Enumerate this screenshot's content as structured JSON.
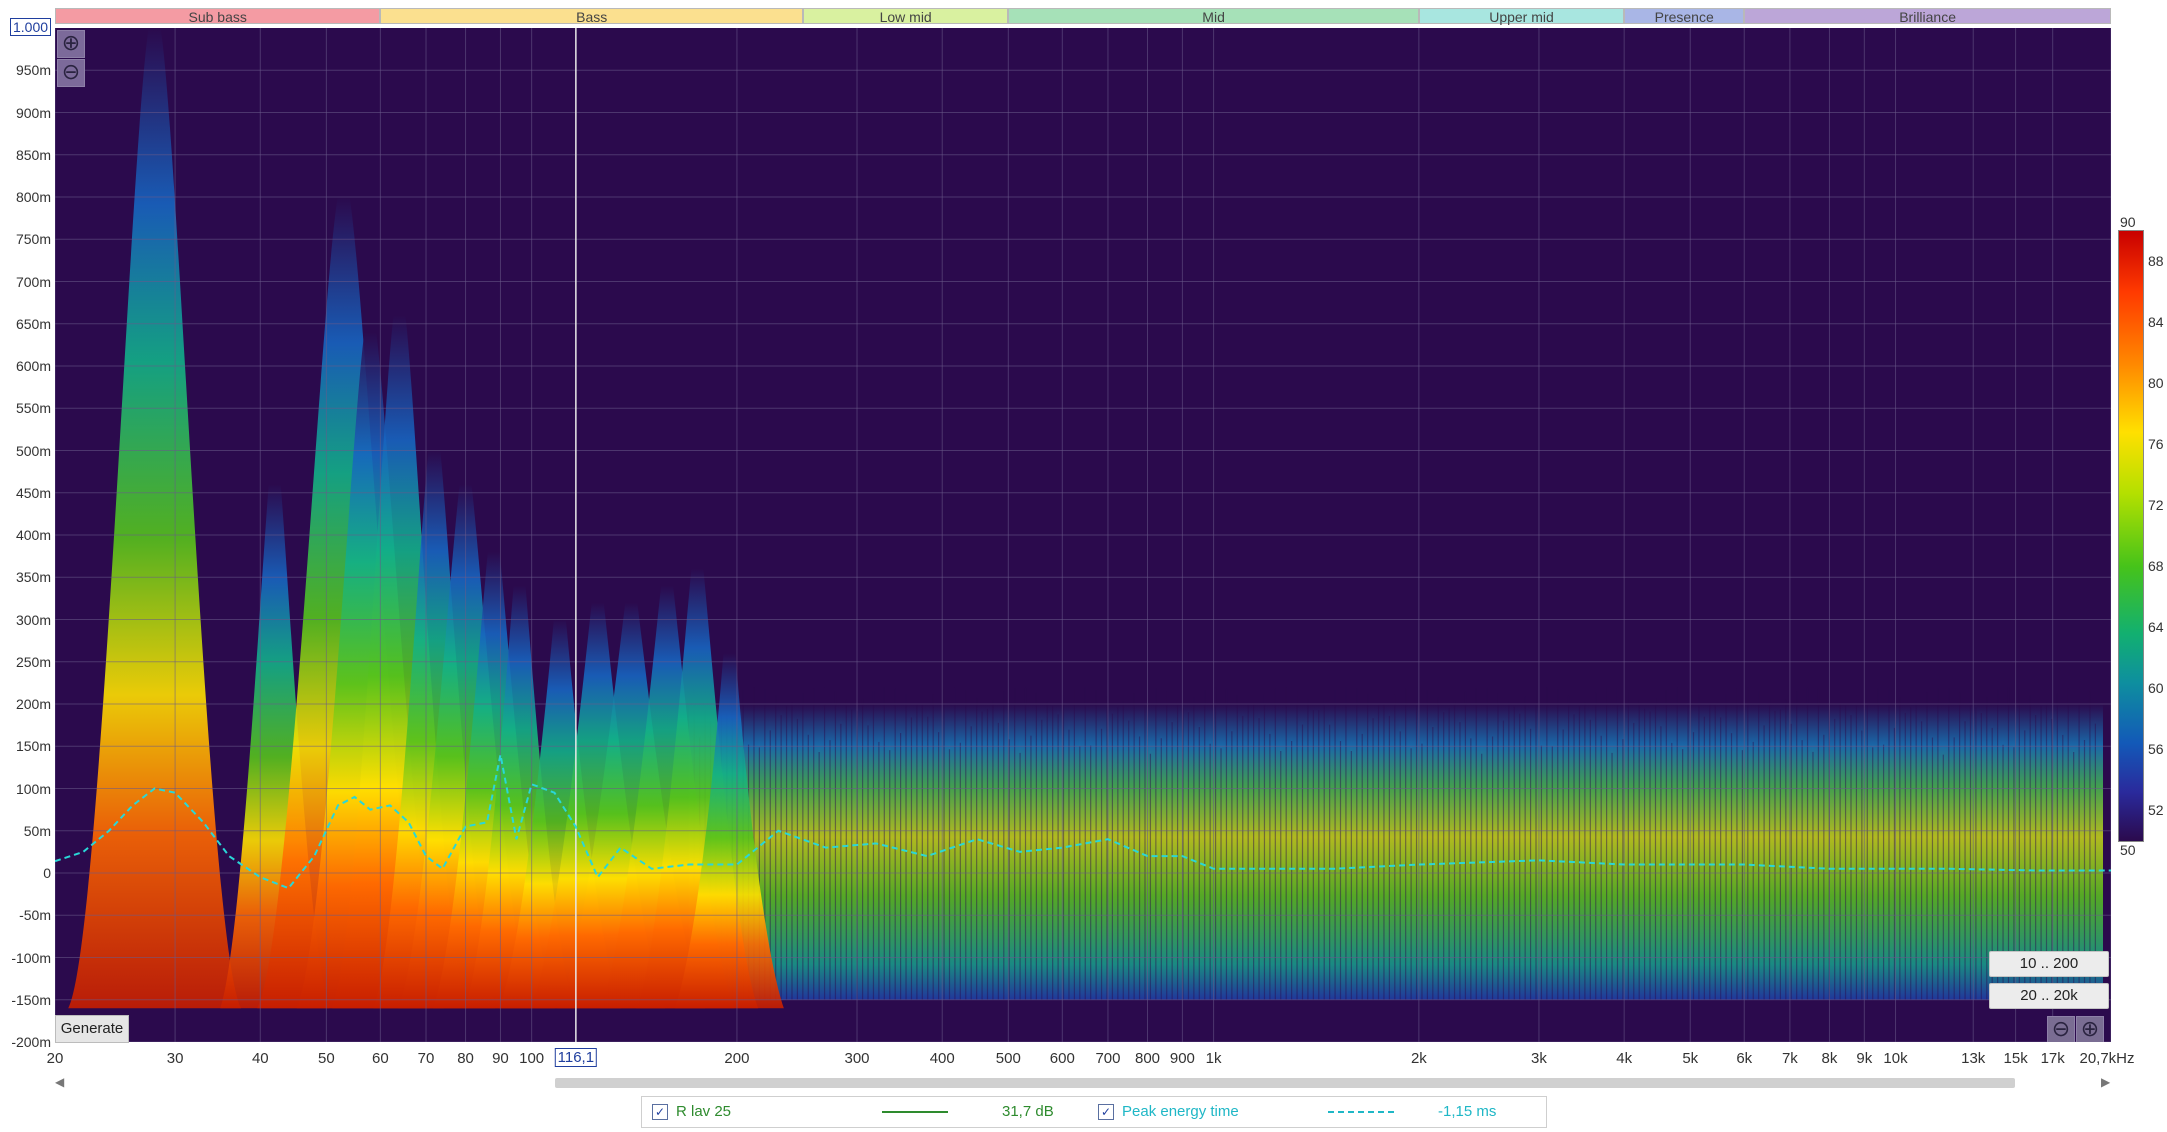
{
  "bands": [
    {
      "label": "Sub bass",
      "color": "#f49ba3",
      "from": 20,
      "to": 60
    },
    {
      "label": "Bass",
      "color": "#fbe08f",
      "from": 60,
      "to": 250
    },
    {
      "label": "Low mid",
      "color": "#d9f1a0",
      "from": 250,
      "to": 500
    },
    {
      "label": "Mid",
      "color": "#a6e1b8",
      "from": 500,
      "to": 2000
    },
    {
      "label": "Upper mid",
      "color": "#a8e6e0",
      "from": 2000,
      "to": 4000
    },
    {
      "label": "Presence",
      "color": "#a9b6e6",
      "from": 4000,
      "to": 6000
    },
    {
      "label": "Brilliance",
      "color": "#bca6d8",
      "from": 6000,
      "to": 20700
    }
  ],
  "top_value": "1.000",
  "cursor_label": "116,1",
  "generate_label": "Generate",
  "range_buttons": [
    "10 .. 200",
    "20 .. 20k"
  ],
  "zoom_in_symbol": "⊕",
  "zoom_out_symbol": "⊖",
  "scroll_left": "◀",
  "scroll_right": "▶",
  "legend": {
    "series1": {
      "checked": "✓",
      "name": "R lav 25",
      "value": "31,7 dB",
      "color": "#2e8b2e"
    },
    "series2": {
      "checked": "✓",
      "name": "Peak energy time",
      "value": "-1,15 ms",
      "color": "#1fb7c6"
    }
  },
  "colors": {
    "background": "#2b0a4d",
    "grid": "#6a5a8a",
    "cursor": "#e8e8e8",
    "peak_line": "#2ad7d7"
  },
  "chart_data": {
    "type": "heatmap",
    "title": "",
    "xlabel": "kHz",
    "ylabel": "",
    "x_scale": "log",
    "xlim_hz": [
      20,
      20700
    ],
    "ylim_ms": [
      -200,
      1000
    ],
    "cursor_hz": 116.1,
    "x_tick_labels": [
      {
        "hz": 20,
        "label": "20"
      },
      {
        "hz": 30,
        "label": "30"
      },
      {
        "hz": 40,
        "label": "40"
      },
      {
        "hz": 50,
        "label": "50"
      },
      {
        "hz": 60,
        "label": "60"
      },
      {
        "hz": 70,
        "label": "70"
      },
      {
        "hz": 80,
        "label": "80"
      },
      {
        "hz": 90,
        "label": "90"
      },
      {
        "hz": 100,
        "label": "100"
      },
      {
        "hz": 200,
        "label": "200"
      },
      {
        "hz": 300,
        "label": "300"
      },
      {
        "hz": 400,
        "label": "400"
      },
      {
        "hz": 500,
        "label": "500"
      },
      {
        "hz": 600,
        "label": "600"
      },
      {
        "hz": 700,
        "label": "700"
      },
      {
        "hz": 800,
        "label": "800"
      },
      {
        "hz": 900,
        "label": "900"
      },
      {
        "hz": 1000,
        "label": "1k"
      },
      {
        "hz": 2000,
        "label": "2k"
      },
      {
        "hz": 3000,
        "label": "3k"
      },
      {
        "hz": 4000,
        "label": "4k"
      },
      {
        "hz": 5000,
        "label": "5k"
      },
      {
        "hz": 6000,
        "label": "6k"
      },
      {
        "hz": 7000,
        "label": "7k"
      },
      {
        "hz": 8000,
        "label": "8k"
      },
      {
        "hz": 9000,
        "label": "9k"
      },
      {
        "hz": 10000,
        "label": "10k"
      },
      {
        "hz": 13000,
        "label": "13k"
      },
      {
        "hz": 15000,
        "label": "15k"
      },
      {
        "hz": 17000,
        "label": "17k"
      },
      {
        "hz": 20700,
        "label": "20,7kHz"
      }
    ],
    "y_tick_labels": [
      {
        "ms": 950,
        "label": "950m"
      },
      {
        "ms": 900,
        "label": "900m"
      },
      {
        "ms": 850,
        "label": "850m"
      },
      {
        "ms": 800,
        "label": "800m"
      },
      {
        "ms": 750,
        "label": "750m"
      },
      {
        "ms": 700,
        "label": "700m"
      },
      {
        "ms": 650,
        "label": "650m"
      },
      {
        "ms": 600,
        "label": "600m"
      },
      {
        "ms": 550,
        "label": "550m"
      },
      {
        "ms": 500,
        "label": "500m"
      },
      {
        "ms": 450,
        "label": "450m"
      },
      {
        "ms": 400,
        "label": "400m"
      },
      {
        "ms": 350,
        "label": "350m"
      },
      {
        "ms": 300,
        "label": "300m"
      },
      {
        "ms": 250,
        "label": "250m"
      },
      {
        "ms": 200,
        "label": "200m"
      },
      {
        "ms": 150,
        "label": "150m"
      },
      {
        "ms": 100,
        "label": "100m"
      },
      {
        "ms": 50,
        "label": "50m"
      },
      {
        "ms": 0,
        "label": "0"
      },
      {
        "ms": -50,
        "label": "-50m"
      },
      {
        "ms": -100,
        "label": "-100m"
      },
      {
        "ms": -150,
        "label": "-150m"
      },
      {
        "ms": -200,
        "label": "-200m"
      }
    ],
    "colorbar": {
      "min": 50,
      "max": 90,
      "labels": [
        "90",
        "88",
        "84",
        "80",
        "76",
        "72",
        "68",
        "64",
        "60",
        "56",
        "52",
        "50"
      ]
    },
    "decay_ridges": [
      {
        "hz": 28,
        "top_ms": 1000,
        "level_db": 88
      },
      {
        "hz": 42,
        "top_ms": 460,
        "level_db": 78
      },
      {
        "hz": 53,
        "top_ms": 800,
        "level_db": 88
      },
      {
        "hz": 58,
        "top_ms": 640,
        "level_db": 84
      },
      {
        "hz": 64,
        "top_ms": 660,
        "level_db": 82
      },
      {
        "hz": 72,
        "top_ms": 500,
        "level_db": 80
      },
      {
        "hz": 80,
        "top_ms": 460,
        "level_db": 82
      },
      {
        "hz": 88,
        "top_ms": 380,
        "level_db": 80
      },
      {
        "hz": 96,
        "top_ms": 340,
        "level_db": 78
      },
      {
        "hz": 110,
        "top_ms": 300,
        "level_db": 80
      },
      {
        "hz": 125,
        "top_ms": 320,
        "level_db": 82
      },
      {
        "hz": 140,
        "top_ms": 320,
        "level_db": 84
      },
      {
        "hz": 158,
        "top_ms": 340,
        "level_db": 82
      },
      {
        "hz": 175,
        "top_ms": 360,
        "level_db": 80
      },
      {
        "hz": 195,
        "top_ms": 260,
        "level_db": 78
      }
    ],
    "peak_energy_time": {
      "hz": [
        20,
        22,
        24,
        26,
        28,
        30,
        33,
        36,
        40,
        44,
        48,
        52,
        55,
        58,
        62,
        66,
        70,
        74,
        80,
        86,
        90,
        95,
        100,
        108,
        116,
        125,
        135,
        150,
        170,
        200,
        230,
        270,
        320,
        380,
        450,
        520,
        600,
        700,
        800,
        900,
        1000,
        1500,
        2000,
        3000,
        4000,
        6000,
        8000,
        12000,
        16000,
        20700
      ],
      "ms": [
        14,
        25,
        50,
        80,
        100,
        95,
        60,
        20,
        -5,
        -18,
        20,
        80,
        90,
        75,
        80,
        60,
        20,
        5,
        55,
        60,
        140,
        40,
        105,
        95,
        55,
        -5,
        30,
        5,
        10,
        10,
        50,
        30,
        35,
        20,
        40,
        25,
        30,
        40,
        20,
        20,
        5,
        5,
        10,
        15,
        10,
        10,
        5,
        5,
        3,
        3
      ]
    }
  }
}
